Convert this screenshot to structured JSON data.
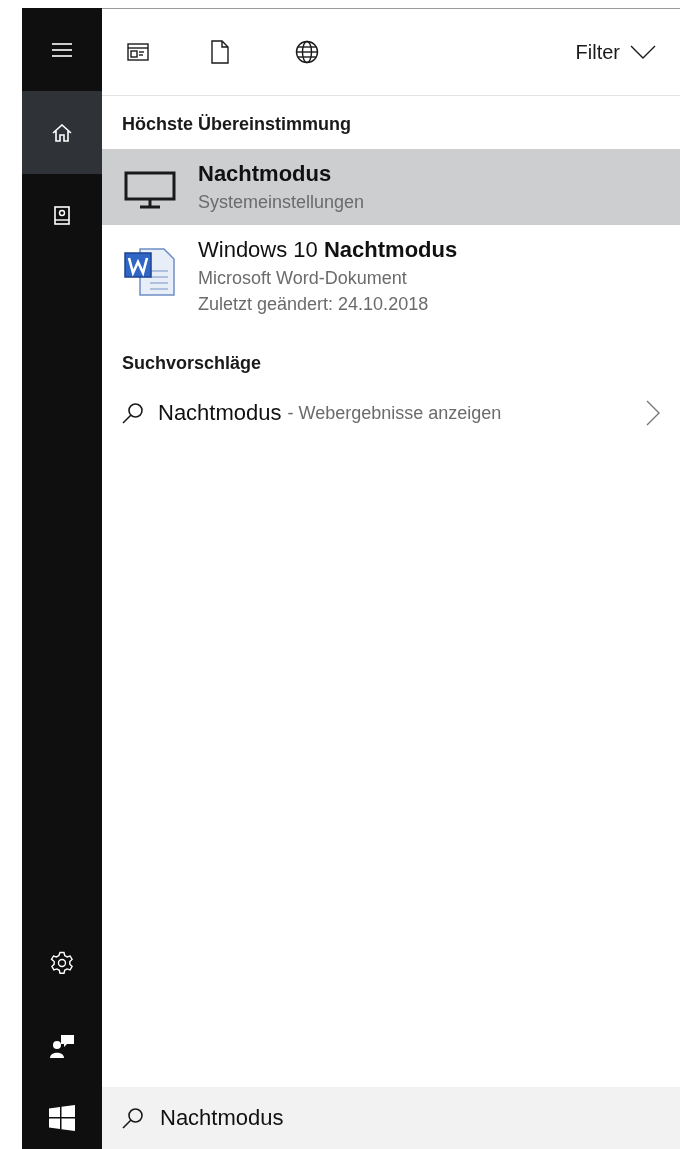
{
  "sidebar": {
    "items": [
      {
        "kind": "menu",
        "selected": false
      },
      {
        "kind": "home",
        "selected": true
      },
      {
        "kind": "notebook",
        "selected": false
      }
    ],
    "bottom_items": [
      {
        "kind": "settings"
      },
      {
        "kind": "feedback"
      },
      {
        "kind": "start"
      }
    ]
  },
  "toolbar": {
    "filters": [
      {
        "kind": "apps"
      },
      {
        "kind": "documents"
      },
      {
        "kind": "web"
      }
    ],
    "filter_label": "Filter"
  },
  "sections": [
    {
      "heading": "Höchste Übereinstimmung",
      "results": [
        {
          "kind": "settings",
          "title": "Nachtmodus",
          "lines": [
            "Systemeinstellungen"
          ],
          "selected": true
        },
        {
          "kind": "document",
          "title": "Windows 10 **Nachtmodus**",
          "lines": [
            "Microsoft Word-Dokument",
            "Zuletzt geändert: 24.10.2018"
          ],
          "selected": false
        }
      ]
    },
    {
      "heading": "Suchvorschläge",
      "suggestions": [
        {
          "query": "Nachtmodus",
          "hint": "- Webergebnisse anzeigen"
        }
      ]
    }
  ],
  "search": {
    "value": "Nachtmodus"
  }
}
